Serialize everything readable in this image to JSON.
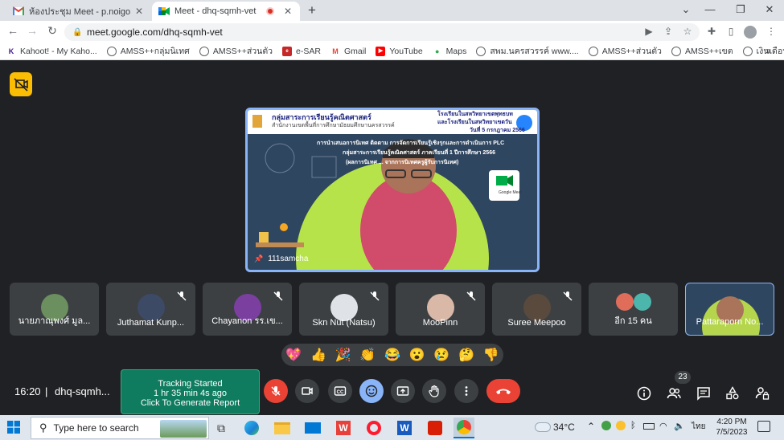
{
  "browser": {
    "tabs": [
      {
        "title": "ห้องประชุม Meet - p.noigor@gmail",
        "favicon": "gmail-icon",
        "active": false
      },
      {
        "title": "Meet - dhq-sqmh-vet",
        "favicon": "meet-icon",
        "active": true
      }
    ],
    "url": "meet.google.com/dhq-sqmh-vet",
    "bookmarks": [
      {
        "label": "Kahoot! - My Kaho...",
        "icon": "kahoot-icon"
      },
      {
        "label": "AMSS++กลุ่มนิเทศ",
        "icon": "globe-icon"
      },
      {
        "label": "AMSS++ส่วนตัว",
        "icon": "globe-icon"
      },
      {
        "label": "e-SAR",
        "icon": "esar-icon"
      },
      {
        "label": "Gmail",
        "icon": "gmail-icon"
      },
      {
        "label": "YouTube",
        "icon": "youtube-icon"
      },
      {
        "label": "Maps",
        "icon": "maps-icon"
      },
      {
        "label": "สพม.นครสวรรค์ www....",
        "icon": "globe-icon"
      },
      {
        "label": "AMSS++ส่วนตัว",
        "icon": "globe-icon"
      },
      {
        "label": "AMSS++เขต",
        "icon": "globe-icon"
      },
      {
        "label": "เงินเดือน",
        "icon": "globe-icon"
      }
    ]
  },
  "meet": {
    "presenter": {
      "name": "111samcha",
      "slide": {
        "org_line1": "กลุ่มสาระการเรียนรู้คณิตศาสตร์",
        "org_line2": "สำนักงานเขตพื้นที่การศึกษามัธยมศึกษานครสวรรค์",
        "school_line1": "โรงเรียนในสหวิทยาเขตพุทธบท",
        "school_line2": "และโรงเรียนในสหวิทยาเขตวัน",
        "date": "วันที่ 5 กรกฎาคม 2566",
        "line1": "การนำเสนอการนิเทศ ติดตาม การจัดการเรียนรู้เชิงรุกและการดำเนินการ PLC",
        "line2": "กลุ่มสาระการเรียนรู้คณิตศาสตร์ ภาคเรียนที่ 1 ปีการศึกษา 2566",
        "line3": "(ผลการนิเทศ ... จากการนิเทศครูผู้รับการนิเทศ)",
        "logo_label": "Google Meet"
      }
    },
    "participants": [
      {
        "name": "นายภาณุพงศ์ มูล...",
        "muted": false,
        "avatar_color": "#6b8f5e"
      },
      {
        "name": "Juthamat Kunp...",
        "muted": true,
        "avatar_color": "#3d4a66"
      },
      {
        "name": "Chayanon รร.เข...",
        "muted": true,
        "avatar_color": "#7b3fa0"
      },
      {
        "name": "Skn Nut (Natsu)",
        "muted": true,
        "avatar_color": "#dfe3e8"
      },
      {
        "name": "MooPinn",
        "muted": true,
        "avatar_color": "#d9b8a8"
      },
      {
        "name": "Suree Meepoo",
        "muted": true,
        "avatar_color": "#5a4a3e"
      },
      {
        "name": "อีก 15 คน",
        "muted": false,
        "avatar_color": "#e06c5a"
      },
      {
        "name": "Pattaraporn No...",
        "muted": false,
        "avatar_color": "#b5d64c"
      }
    ],
    "reactions": [
      "💖",
      "👍",
      "🎉",
      "👏",
      "😂",
      "😮",
      "😢",
      "🤔",
      "👎"
    ],
    "time": "16:20",
    "meeting_code": "dhq-sqmh...",
    "tracker": {
      "line1": "Tracking Started",
      "line2": "1 hr 35 min 4s ago",
      "line3": "Click To Generate Report"
    },
    "people_count": "23",
    "accent_end_call": "#ea4335",
    "accent_reactions": "#8ab4f8"
  },
  "taskbar": {
    "search_placeholder": "Type here to search",
    "weather": "34°C",
    "language": "ไทย",
    "clock_time": "4:20 PM",
    "clock_date": "7/5/2023"
  }
}
